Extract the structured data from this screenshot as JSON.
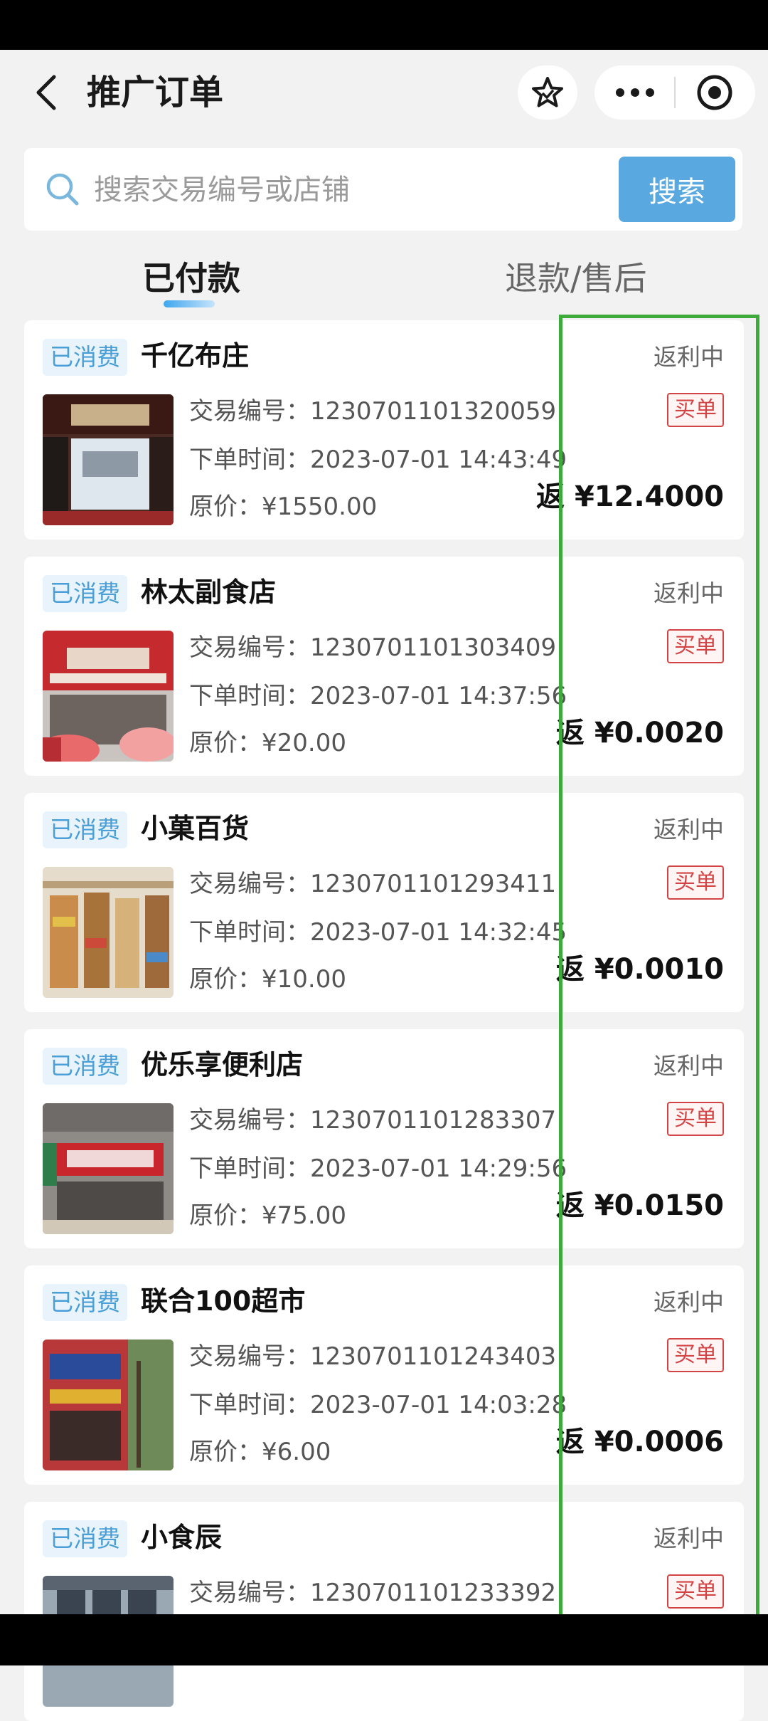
{
  "header": {
    "title": "推广订单"
  },
  "search": {
    "placeholder": "搜索交易编号或店铺",
    "button_label": "搜索"
  },
  "tabs": [
    {
      "label": "已付款",
      "active": true
    },
    {
      "label": "退款/售后",
      "active": false
    }
  ],
  "labels": {
    "trade_no": "交易编号：",
    "order_time": "下单时间：",
    "original_price": "原价：",
    "rebate_prefix": "返 "
  },
  "orders": [
    {
      "status": "已消费",
      "store": "千亿布庄",
      "trade_no": "1230701101320059",
      "order_time": "2023-07-01 14:43:49",
      "price": "¥1550.00",
      "rebate_state": "返利中",
      "tag": "买单",
      "rebate": "¥12.4000"
    },
    {
      "status": "已消费",
      "store": "林太副食店",
      "trade_no": "1230701101303409",
      "order_time": "2023-07-01 14:37:56",
      "price": "¥20.00",
      "rebate_state": "返利中",
      "tag": "买单",
      "rebate": "¥0.0020"
    },
    {
      "status": "已消费",
      "store": "小菓百货",
      "trade_no": "1230701101293411",
      "order_time": "2023-07-01 14:32:45",
      "price": "¥10.00",
      "rebate_state": "返利中",
      "tag": "买单",
      "rebate": "¥0.0010"
    },
    {
      "status": "已消费",
      "store": "优乐享便利店",
      "trade_no": "1230701101283307",
      "order_time": "2023-07-01 14:29:56",
      "price": "¥75.00",
      "rebate_state": "返利中",
      "tag": "买单",
      "rebate": "¥0.0150"
    },
    {
      "status": "已消费",
      "store": "联合100超市",
      "trade_no": "1230701101243403",
      "order_time": "2023-07-01 14:03:28",
      "price": "¥6.00",
      "rebate_state": "返利中",
      "tag": "买单",
      "rebate": "¥0.0006"
    },
    {
      "status": "已消费",
      "store": "小食辰",
      "trade_no": "1230701101233392",
      "order_time": "",
      "price": "",
      "rebate_state": "返利中",
      "tag": "买单",
      "rebate": ""
    }
  ],
  "colors": {
    "accent_blue": "#5aa8e0",
    "tag_red": "#d34545",
    "highlight_green": "#3faa3c"
  }
}
